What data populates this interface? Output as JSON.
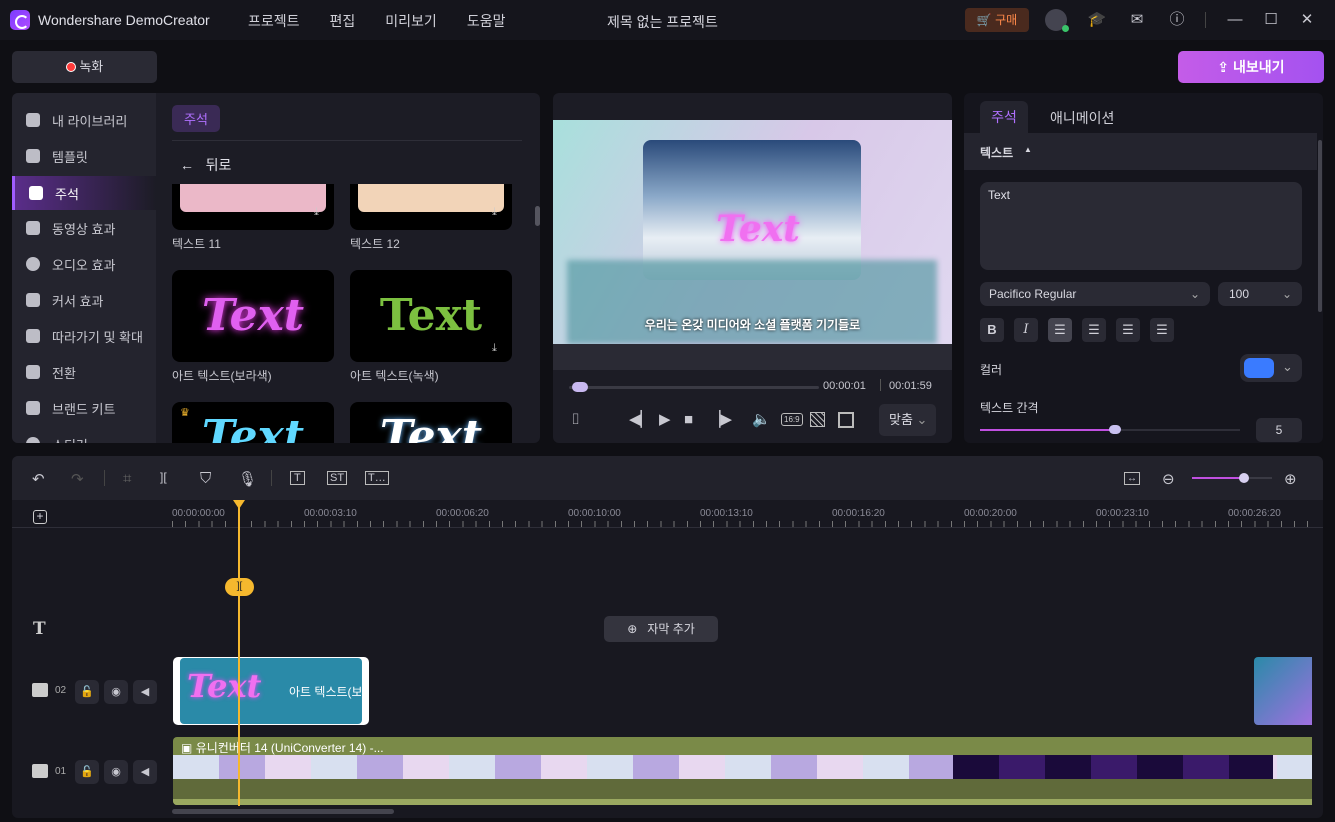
{
  "app": {
    "title": "Wondershare DemoCreator",
    "project_title": "제목 없는 프로젝트",
    "menu": [
      "프로젝트",
      "편집",
      "미리보기",
      "도움말"
    ],
    "buy_label": "구매",
    "record_label": "녹화",
    "export_label": "내보내기"
  },
  "sidebar": {
    "items": [
      {
        "label": "내 라이브러리",
        "icon": "layers-icon"
      },
      {
        "label": "템플릿",
        "icon": "template-icon"
      },
      {
        "label": "주석",
        "icon": "annotation-icon",
        "active": true
      },
      {
        "label": "동영상 효과",
        "icon": "video-effect-icon"
      },
      {
        "label": "오디오 효과",
        "icon": "audio-effect-icon"
      },
      {
        "label": "커서 효과",
        "icon": "cursor-effect-icon"
      },
      {
        "label": "따라가기 및 확대",
        "icon": "zoom-follow-icon"
      },
      {
        "label": "전환",
        "icon": "transition-icon"
      },
      {
        "label": "브랜드 키트",
        "icon": "brand-kit-icon"
      },
      {
        "label": "스티커",
        "icon": "sticker-icon"
      }
    ]
  },
  "library": {
    "category_tag": "주석",
    "back_label": "뒤로",
    "items": [
      {
        "label": "텍스트 11"
      },
      {
        "label": "텍스트 12"
      },
      {
        "label": "아트 텍스트(보라색)",
        "preview": "Text"
      },
      {
        "label": "아트 텍스트(녹색)",
        "preview": "Text"
      },
      {
        "preview": "Text"
      },
      {
        "preview": "Text"
      }
    ]
  },
  "preview": {
    "overlay_text": "Text",
    "subtitle": "우리는 온갖 미디어와 소셜 플랫폼 기기들로",
    "current_time": "00:00:01",
    "total_time": "00:01:59",
    "aspect_label": "16:9",
    "fit_label": "맞춤",
    "progress_fraction": 0.01
  },
  "properties": {
    "tabs": [
      "주석",
      "애니메이션"
    ],
    "active_tab": "주석",
    "section_label": "텍스트",
    "text_value": "Text",
    "font": "Pacifico Regular",
    "font_size": "100",
    "color_label": "컬러",
    "color_value": "#3a7bff",
    "spacing_label": "텍스트 간격",
    "spacing_value": "5",
    "spacing_fraction": 0.52
  },
  "timeline": {
    "ruler": [
      "00:00:00:00",
      "00:00:03:10",
      "00:00:06:20",
      "00:00:10:00",
      "00:00:13:10",
      "00:00:16:20",
      "00:00:20:00",
      "00:00:23:10",
      "00:00:26:20"
    ],
    "add_subtitle_label": "자막 추가",
    "tracks": [
      {
        "number": "02",
        "clip_label": "아트 텍스트(보",
        "clip_preview": "Text"
      },
      {
        "number": "01",
        "clip_label": "유니컨버터 14 (UniConverter 14) -..."
      }
    ],
    "zoom_fraction": 0.65
  },
  "colors": {
    "accent": "#a05cff",
    "export_gradient": "#b65cf0",
    "playhead": "#f5b82e"
  }
}
